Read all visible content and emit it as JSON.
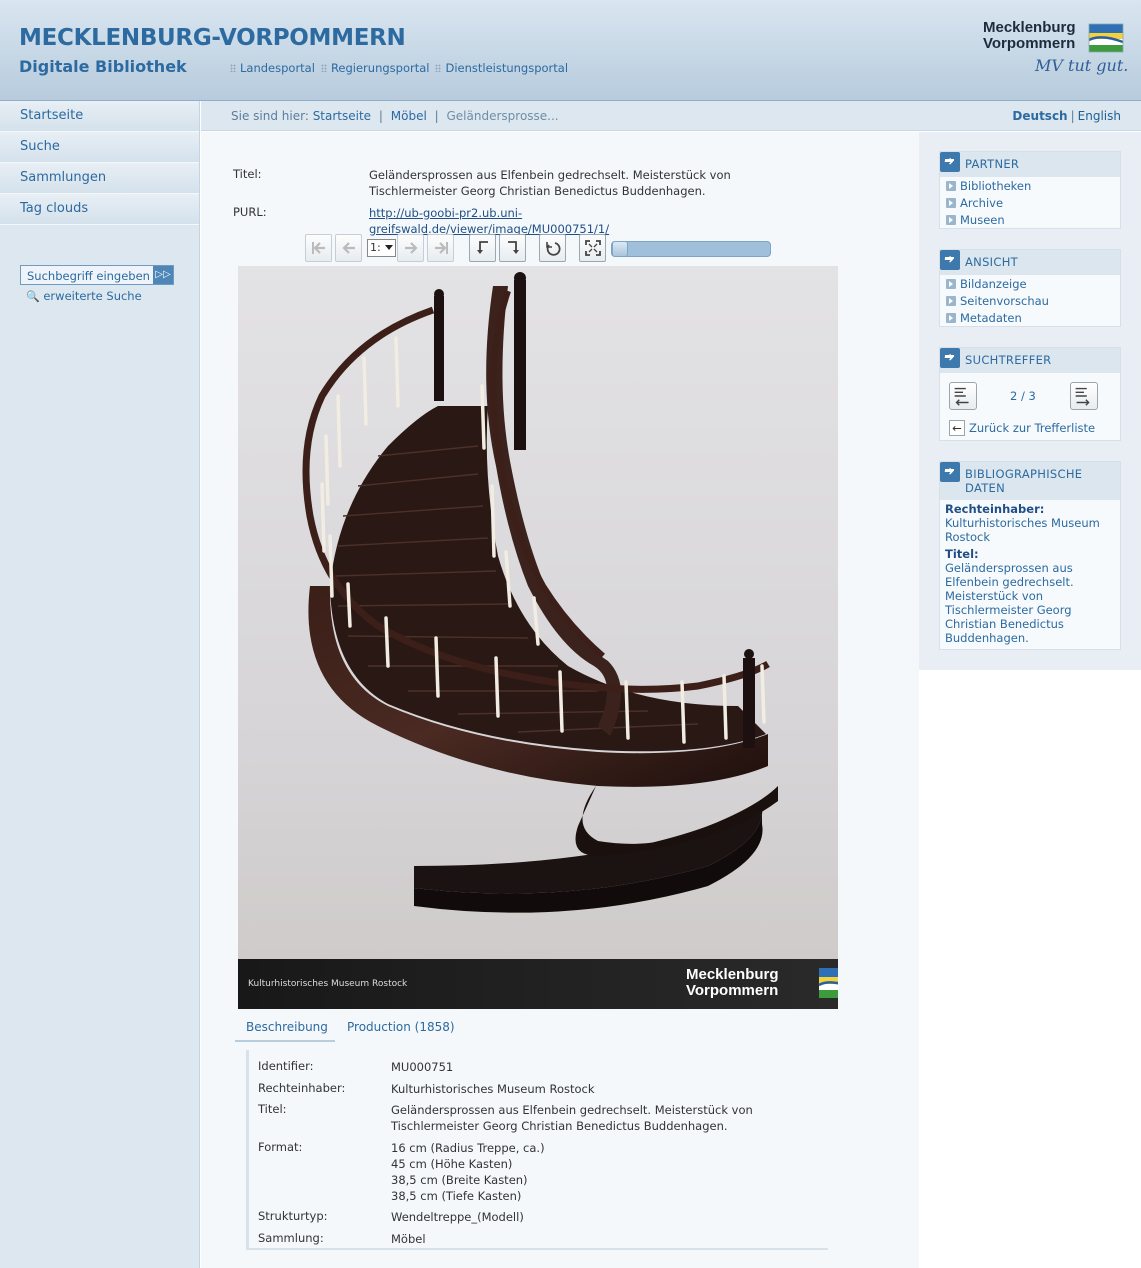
{
  "header": {
    "title": "MECKLENBURG-VORPOMMERN",
    "subtitle": "Digitale Bibliothek",
    "portal_links": [
      "Landesportal",
      "Regierungsportal",
      "Dienstleistungsportal"
    ],
    "logo_line1": "Mecklenburg",
    "logo_line2": "Vorpommern",
    "logo_slogan": "MV tut gut."
  },
  "sidebar": {
    "items": [
      "Startseite",
      "Suche",
      "Sammlungen",
      "Tag clouds"
    ],
    "search_placeholder": "Suchbegriff eingeben",
    "advanced_search": "erweiterte Suche"
  },
  "breadcrumb": {
    "prefix": "Sie sind hier:",
    "items": [
      "Startseite",
      "Möbel",
      "Geländersprosse..."
    ]
  },
  "language": {
    "active": "Deutsch",
    "other": "English"
  },
  "record": {
    "title_label": "Titel:",
    "title_line1": "Geländersprossen aus Elfenbein gedrechselt. Meisterstück von",
    "title_line2": "Tischlermeister Georg Christian Benedictus Buddenhagen.",
    "purl_label": "PURL:",
    "purl": "http://ub-goobi-pr2.ub.uni-greifswald.de/viewer/image/MU000751/1/"
  },
  "viewer": {
    "page_value": "1:",
    "zoom_level": 0,
    "image_credit": "Kulturhistorisches Museum Rostock",
    "image_logo_line1": "Mecklenburg",
    "image_logo_line2": "Vorpommern"
  },
  "tabs": [
    "Beschreibung",
    "Production (1858)"
  ],
  "description": {
    "identifier_label": "Identifier:",
    "identifier": "MU000751",
    "rights_label": "Rechteinhaber:",
    "rights": "Kulturhistorisches Museum Rostock",
    "title_label": "Titel:",
    "title_line1": "Geländersprossen aus Elfenbein gedrechselt. Meisterstück von",
    "title_line2": "Tischlermeister Georg Christian Benedictus Buddenhagen.",
    "format_label": "Format:",
    "format": [
      "16 cm (Radius Treppe, ca.)",
      "45 cm (Höhe Kasten)",
      "38,5 cm (Breite Kasten)",
      "38,5 cm (Tiefe Kasten)"
    ],
    "structure_label": "Strukturtyp:",
    "structure": "Wendeltreppe_(Modell)",
    "collection_label": "Sammlung:",
    "collection": "Möbel"
  },
  "right": {
    "partner_title": "PARTNER",
    "partner_items": [
      "Bibliotheken",
      "Archive",
      "Museen"
    ],
    "view_title": "ANSICHT",
    "view_items": [
      "Bildanzeige",
      "Seitenvorschau",
      "Metadaten"
    ],
    "hits_title": "SUCHTREFFER",
    "hits_count": "2 / 3",
    "hits_back": "Zurück zur Trefferliste",
    "bib_title_line1": "BIBLIOGRAPHISCHE",
    "bib_title_line2": "DATEN",
    "bib_rights_label": "Rechteinhaber:",
    "bib_rights_line1": "Kulturhistorisches Museum",
    "bib_rights_line2": "Rostock",
    "bib_title_label": "Titel:",
    "bib_title_lines": [
      "Geländersprossen aus",
      "Elfenbein gedrechselt.",
      "Meisterstück von",
      "Tischlermeister Georg",
      "Christian Benedictus",
      "Buddenhagen."
    ]
  },
  "colors": {
    "brand_blue": "#2c6aa0",
    "header_bg": "#b7cbdd",
    "sidebar_bg": "#dde7ef"
  }
}
